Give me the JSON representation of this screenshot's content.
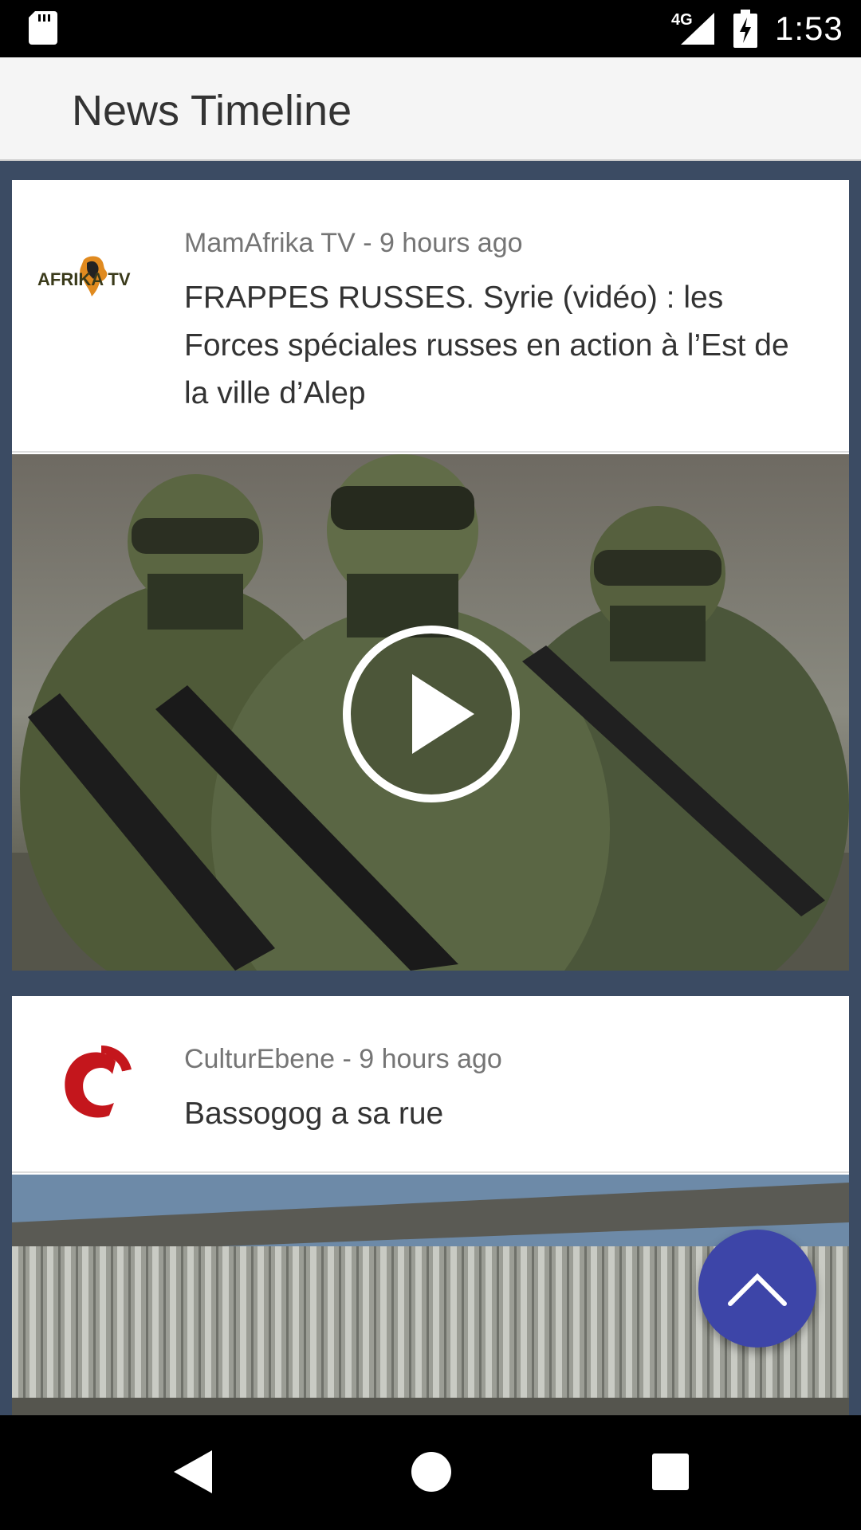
{
  "status_bar": {
    "network": "4G",
    "time": "1:53",
    "icons": [
      "sd-card-icon",
      "signal-icon",
      "battery-charging-icon"
    ]
  },
  "app_bar": {
    "title": "News Timeline"
  },
  "feed": {
    "items": [
      {
        "source": "MamAfrika TV",
        "time_ago": "9 hours ago",
        "meta": "MamAfrika TV - 9 hours ago",
        "headline": "FRAPPES RUSSES. Syrie (vidéo) : les Forces spéciales russes en action à l’Est de la ville d’Alep",
        "logo_text": "AFRIKA TV",
        "media": "video-thumbnail",
        "has_play_button": true
      },
      {
        "source": "CulturEbene",
        "time_ago": "9 hours ago",
        "meta": "CulturEbene - 9 hours ago",
        "headline": "Bassogog a sa rue",
        "logo_text": "C",
        "media": "image-thumbnail",
        "has_play_button": false
      }
    ]
  },
  "fab": {
    "icon": "chevron-up-icon",
    "color": "#3d45a8"
  },
  "nav_bar": {
    "icons": [
      "back-icon",
      "home-icon",
      "recents-icon"
    ]
  },
  "colors": {
    "feed_background": "#3b4b63",
    "app_bar": "#f5f5f5",
    "status_bar": "#000000",
    "meta_text": "#757575",
    "headline_text": "#333333",
    "culturebene_red": "#c4161c"
  }
}
